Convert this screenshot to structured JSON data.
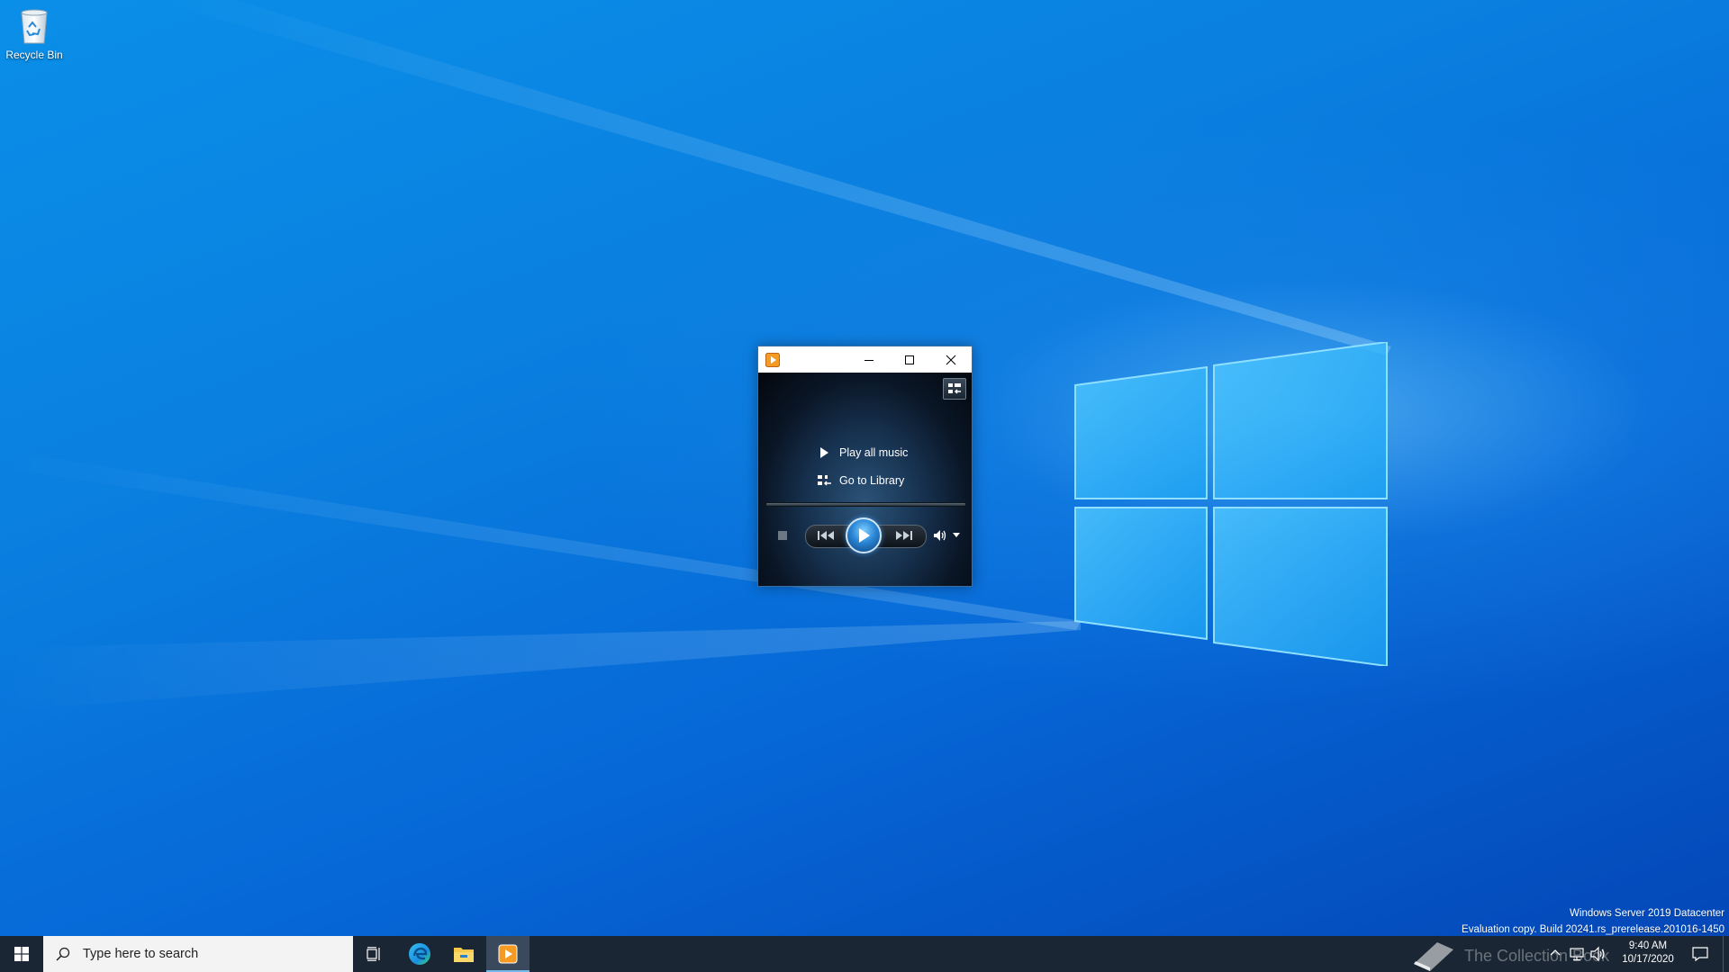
{
  "desktop": {
    "icons": [
      {
        "label": "Recycle Bin",
        "icon": "recycle-bin-icon"
      }
    ],
    "watermark": {
      "line1": "Windows Server 2019 Datacenter",
      "line2": "Evaluation copy. Build 20241.rs_prerelease.201016-1450"
    }
  },
  "wmp": {
    "title": "",
    "app_icon": "windows-media-player-icon",
    "caption": {
      "minimize_icon": "minimize-icon",
      "maximize_icon": "maximize-icon",
      "close_icon": "close-icon"
    },
    "switch_icon": "switch-to-library-icon",
    "links": {
      "play_all": "Play all music",
      "go_library": "Go to Library"
    },
    "controls": {
      "stop": "stop-icon",
      "previous": "previous-icon",
      "play": "play-icon",
      "next": "next-icon",
      "volume": "volume-icon",
      "volume_menu": "chevron-down-icon"
    }
  },
  "taskbar": {
    "search_placeholder": "Type here to search",
    "pinned": [
      "task-view-icon",
      "edge-icon",
      "file-explorer-icon",
      "windows-media-player-icon"
    ],
    "tray": {
      "watermark_text": "The Collection Book",
      "time": "9:40 AM",
      "date": "10/17/2020"
    }
  },
  "colors": {
    "taskbar": "#1a2633",
    "desktop_accent": "#0a7fe0",
    "play_button": "#2a86d6"
  }
}
